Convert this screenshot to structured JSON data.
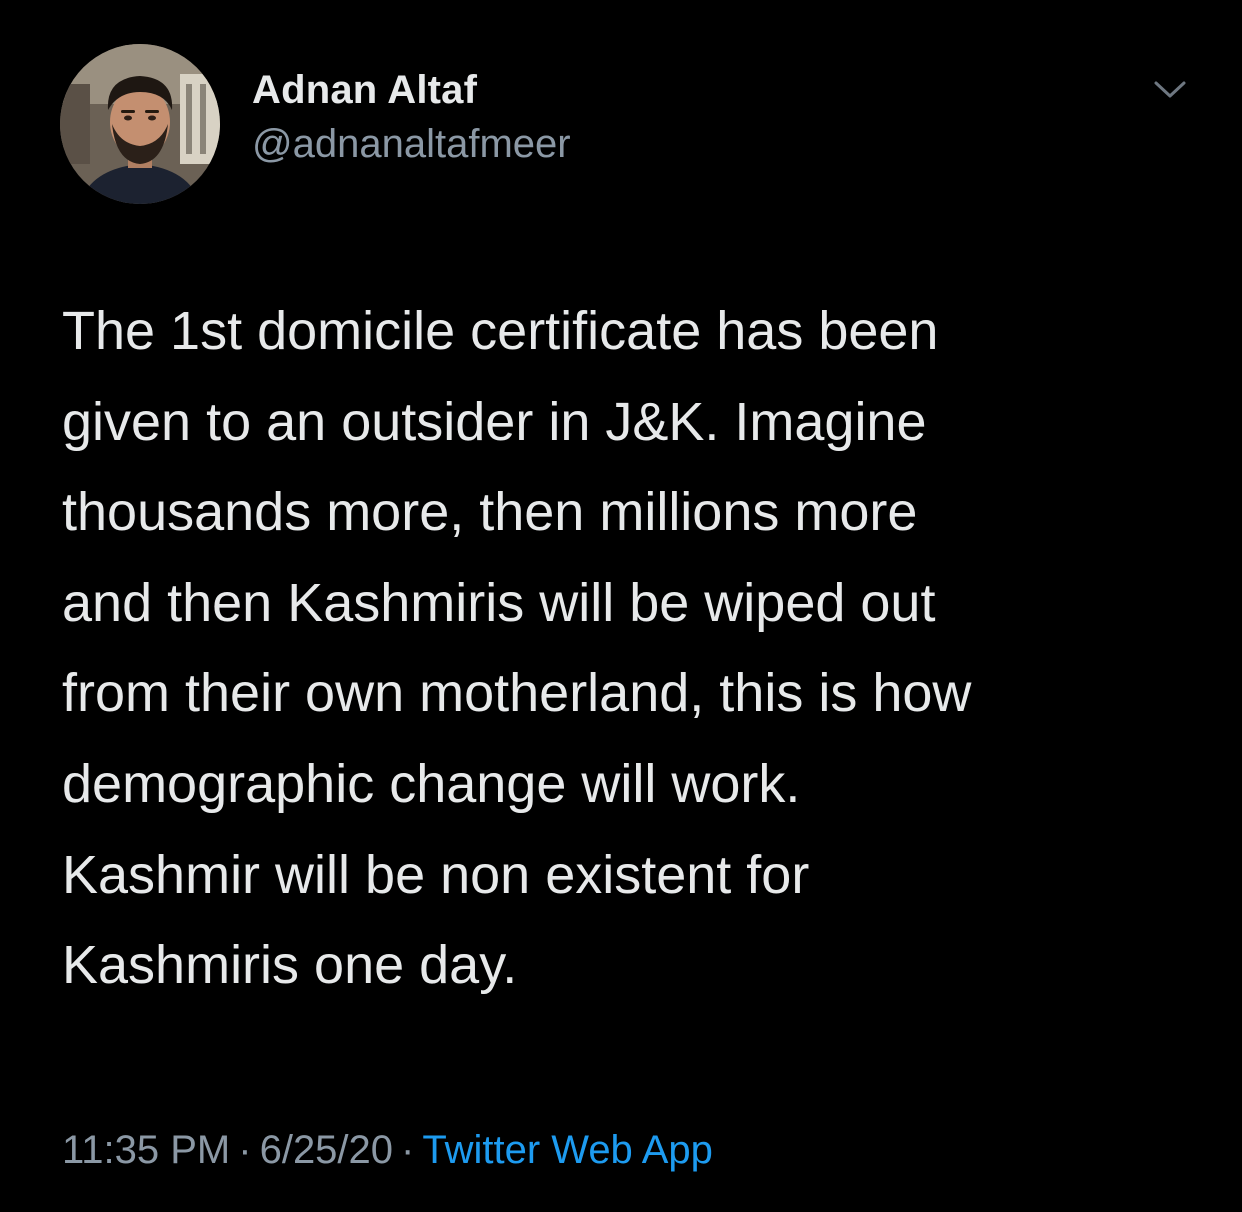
{
  "author": {
    "display_name": "Adnan Altaf",
    "handle": "@adnanaltafmeer"
  },
  "avatar_icon": "profile-photo-icon",
  "menu_icon": "chevron-down-icon",
  "tweet": {
    "lines": [
      "The 1st domicile certificate has been",
      "given to an outsider in J&K. Imagine",
      "thousands more, then millions more",
      "and then Kashmiris will be wiped out",
      "from their own motherland, this is how",
      "demographic change will work.",
      "Kashmir will be non existent for",
      "Kashmiris one day."
    ]
  },
  "meta": {
    "time": "11:35 PM",
    "separator": "·",
    "date": "6/25/20",
    "source": "Twitter Web App"
  },
  "colors": {
    "background": "#000000",
    "text_primary": "#e7e9ea",
    "text_secondary": "#8b98a5",
    "link": "#1d9bf0"
  }
}
